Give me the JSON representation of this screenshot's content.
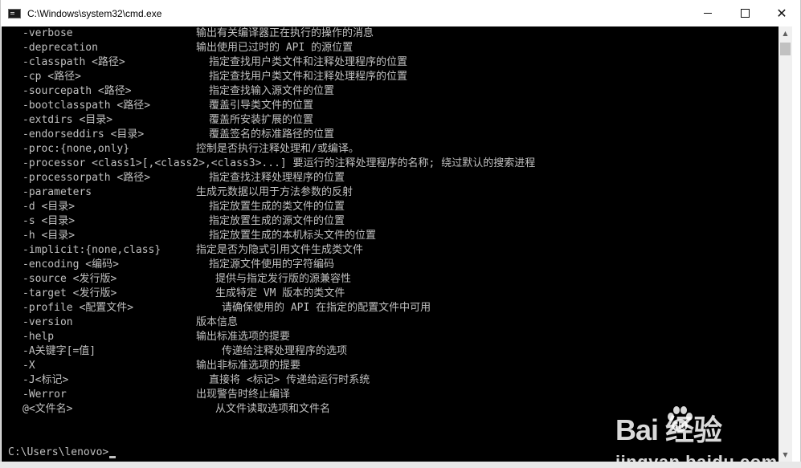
{
  "window": {
    "title": "C:\\Windows\\system32\\cmd.exe",
    "minimize_glyph": "",
    "close_glyph": "✕"
  },
  "console": {
    "lines": [
      {
        "option": "-verbose",
        "description": "输出有关编译器正在执行的操作的消息",
        "indent": 0
      },
      {
        "option": "-deprecation",
        "description": "输出使用已过时的 API 的源位置",
        "indent": 0
      },
      {
        "option": "-classpath <路径>",
        "description": "指定查找用户类文件和注释处理程序的位置",
        "indent": 2
      },
      {
        "option": "-cp <路径>",
        "description": "指定查找用户类文件和注释处理程序的位置",
        "indent": 2
      },
      {
        "option": "-sourcepath <路径>",
        "description": "指定查找输入源文件的位置",
        "indent": 2
      },
      {
        "option": "-bootclasspath <路径>",
        "description": "覆盖引导类文件的位置",
        "indent": 2
      },
      {
        "option": "-extdirs <目录>",
        "description": "覆盖所安装扩展的位置",
        "indent": 2
      },
      {
        "option": "-endorseddirs <目录>",
        "description": "覆盖签名的标准路径的位置",
        "indent": 2
      },
      {
        "option": "-proc:{none,only}",
        "description": "控制是否执行注释处理和/或编译。",
        "indent": 0
      },
      {
        "option": "-processor <class1>[,<class2>,<class3>...] 要运行的注释处理程序的名称; 绕过默认的搜索进程",
        "description": "",
        "indent": 0
      },
      {
        "option": "-processorpath <路径>",
        "description": "指定查找注释处理程序的位置",
        "indent": 2
      },
      {
        "option": "-parameters",
        "description": "生成元数据以用于方法参数的反射",
        "indent": 0
      },
      {
        "option": "-d <目录>",
        "description": "指定放置生成的类文件的位置",
        "indent": 2
      },
      {
        "option": "-s <目录>",
        "description": "指定放置生成的源文件的位置",
        "indent": 2
      },
      {
        "option": "-h <目录>",
        "description": "指定放置生成的本机标头文件的位置",
        "indent": 2
      },
      {
        "option": "-implicit:{none,class}",
        "description": "指定是否为隐式引用文件生成类文件",
        "indent": 0
      },
      {
        "option": "-encoding <编码>",
        "description": "指定源文件使用的字符编码",
        "indent": 2
      },
      {
        "option": "-source <发行版>",
        "description": "提供与指定发行版的源兼容性",
        "indent": 3
      },
      {
        "option": "-target <发行版>",
        "description": "生成特定 VM 版本的类文件",
        "indent": 3
      },
      {
        "option": "-profile <配置文件>",
        "description": "请确保使用的 API 在指定的配置文件中可用",
        "indent": 4
      },
      {
        "option": "-version",
        "description": "版本信息",
        "indent": 0
      },
      {
        "option": "-help",
        "description": "输出标准选项的提要",
        "indent": 0
      },
      {
        "option": "-A关键字[=值]",
        "description": "传递给注释处理程序的选项",
        "indent": 4
      },
      {
        "option": "-X",
        "description": "输出非标准选项的提要",
        "indent": 0
      },
      {
        "option": "-J<标记>",
        "description": "直接将 <标记> 传递给运行时系统",
        "indent": 2
      },
      {
        "option": "-Werror",
        "description": "出现警告时终止编译",
        "indent": 0
      },
      {
        "option": "@<文件名>",
        "description": "从文件读取选项和文件名",
        "indent": 3
      }
    ],
    "prompt": "C:\\Users\\lenovo>"
  },
  "watermark": {
    "logo_text": "Bai 经验",
    "url": "jingyan.baidu.com",
    "icon": "baidu-paw-icon"
  },
  "colors": {
    "console_bg": "#000000",
    "console_fg": "#c0c0c0",
    "titlebar_bg": "#ffffff"
  }
}
